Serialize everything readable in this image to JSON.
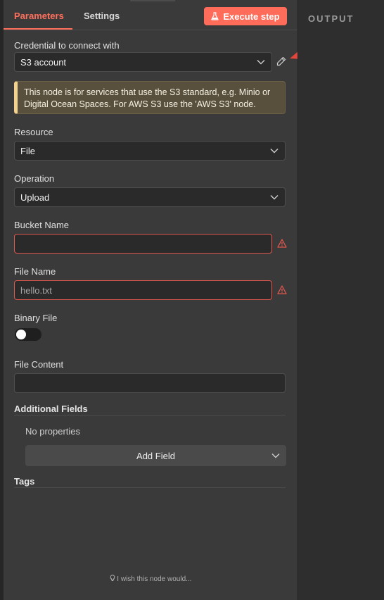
{
  "tabs": {
    "parameters": "Parameters",
    "settings": "Settings"
  },
  "execute_button": "Execute step",
  "credential": {
    "label": "Credential to connect with",
    "value": "S3 account"
  },
  "notice": "This node is for services that use the S3 standard, e.g. Minio or Digital Ocean Spaces. For AWS S3 use the 'AWS S3' node.",
  "resource": {
    "label": "Resource",
    "value": "File"
  },
  "operation": {
    "label": "Operation",
    "value": "Upload"
  },
  "bucket_name": {
    "label": "Bucket Name",
    "value": ""
  },
  "file_name": {
    "label": "File Name",
    "value": "hello.txt"
  },
  "binary_file": {
    "label": "Binary File",
    "enabled": false
  },
  "file_content": {
    "label": "File Content",
    "value": ""
  },
  "additional_fields": {
    "title": "Additional Fields",
    "empty_text": "No properties",
    "add_button": "Add Field"
  },
  "tags": {
    "title": "Tags"
  },
  "wish_link": "I wish this node would...",
  "output": {
    "title": "OUTPUT"
  },
  "colors": {
    "accent": "#ff6d5a",
    "error": "#e0574e",
    "notice_border": "#f2d28e"
  }
}
